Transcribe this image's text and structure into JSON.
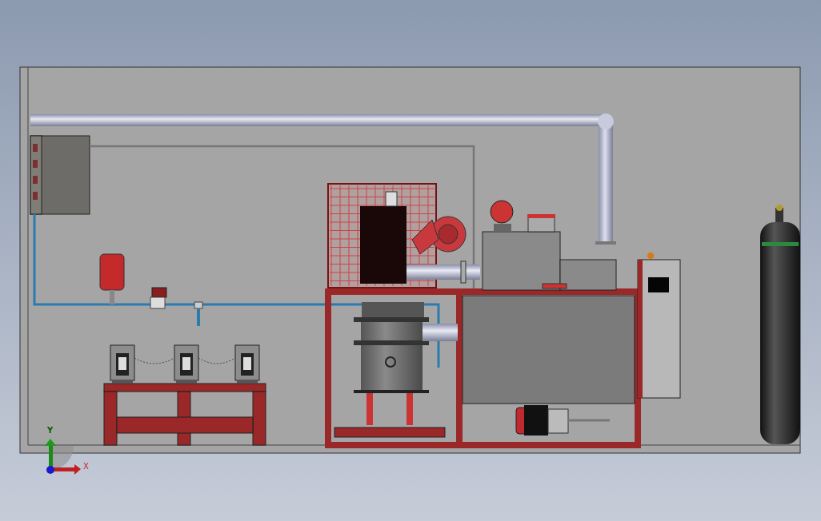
{
  "viewport": {
    "axis_labels": [
      "X",
      "Y"
    ]
  }
}
